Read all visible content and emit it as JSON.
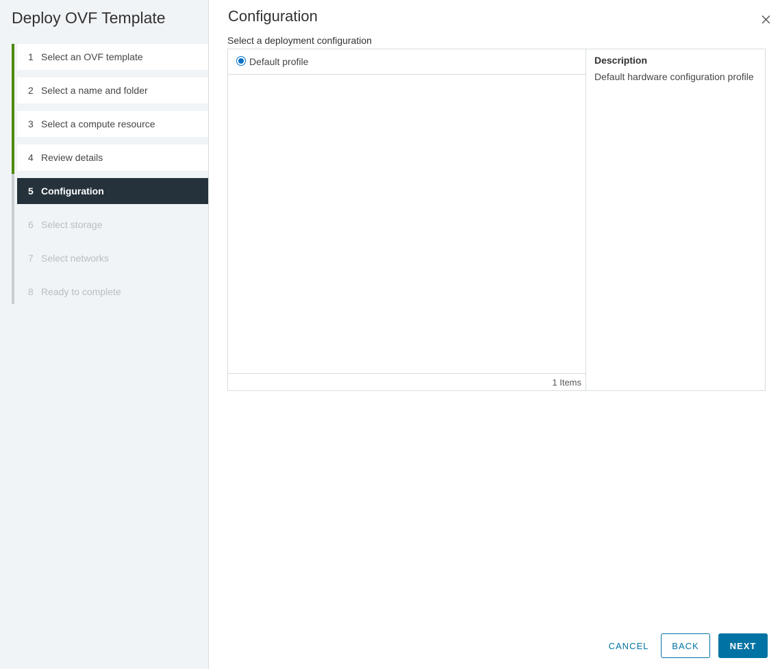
{
  "wizard": {
    "title": "Deploy OVF Template",
    "steps": [
      {
        "num": "1",
        "label": "Select an OVF template",
        "state": "complete"
      },
      {
        "num": "2",
        "label": "Select a name and folder",
        "state": "complete"
      },
      {
        "num": "3",
        "label": "Select a compute resource",
        "state": "complete"
      },
      {
        "num": "4",
        "label": "Review details",
        "state": "complete"
      },
      {
        "num": "5",
        "label": "Configuration",
        "state": "current"
      },
      {
        "num": "6",
        "label": "Select storage",
        "state": "pending"
      },
      {
        "num": "7",
        "label": "Select networks",
        "state": "pending"
      },
      {
        "num": "8",
        "label": "Ready to complete",
        "state": "pending"
      }
    ]
  },
  "content": {
    "title": "Configuration",
    "subtitle": "Select a deployment configuration",
    "close_icon": "close-icon"
  },
  "grid": {
    "rows": [
      {
        "label": "Default profile",
        "selected": true
      }
    ],
    "footer": "1 Items"
  },
  "description": {
    "heading": "Description",
    "text": "Default hardware configuration profile"
  },
  "buttons": {
    "cancel": "CANCEL",
    "back": "BACK",
    "next": "NEXT"
  },
  "colors": {
    "complete_bar": "#4f8a10",
    "current_bg": "#25323b",
    "primary": "#0072a3"
  }
}
